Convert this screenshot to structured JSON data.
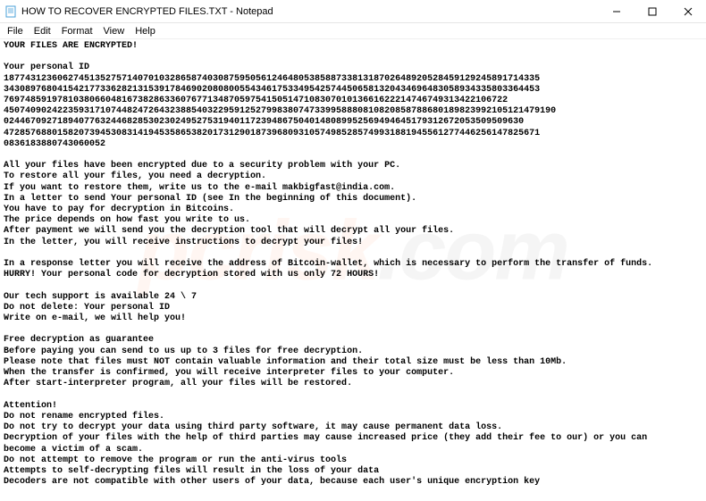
{
  "window": {
    "title": "HOW TO RECOVER ENCRYPTED FILES.TXT - Notepad",
    "app_icon": "notepad-icon"
  },
  "menu": {
    "items": [
      "File",
      "Edit",
      "Format",
      "View",
      "Help"
    ]
  },
  "watermark": {
    "a": "pcrisk",
    "b": ".com"
  },
  "body_text": "YOUR FILES ARE ENCRYPTED!\n\nYour personal ID\n1877431236062745135275714070103286587403087595056124648053858873381318702648920528459129245891714335\n3430897680415421773362821315391784690208080055434617533495425744506581320434696483058934335803364453\n7697485919781038066048167382863360767713487059754150514710830701013661622214746749313422106722\n4507409024223593171074482472643238854032295912527998380747339958880810820858788680189823992105121479190\n0244670927189407763244682853023024952753194011723948675040148089952569494645179312672053509509630\n4728576880158207394530831419453586538201731290187396809310574985285749931881945561277446256147825671\n0836183880743060052\n\nAll your files have been encrypted due to a security problem with your PC.\nTo restore all your files, you need a decryption.\nIf you want to restore them, write us to the e-mail makbigfast@india.com.\nIn a letter to send Your personal ID (see In the beginning of this document).\nYou have to pay for decryption in Bitcoins.\nThe price depends on how fast you write to us.\nAfter payment we will send you the decryption tool that will decrypt all your files.\nIn the letter, you will receive instructions to decrypt your files!\n\nIn a response letter you will receive the address of Bitcoin-wallet, which is necessary to perform the transfer of funds.\nHURRY! Your personal code for decryption stored with us only 72 HOURS!\n\nOur tech support is available 24 \\ 7\nDo not delete: Your personal ID\nWrite on e-mail, we will help you!\n\nFree decryption as guarantee\nBefore paying you can send to us up to 3 files for free decryption.\nPlease note that files must NOT contain valuable information and their total size must be less than 10Mb.\nWhen the transfer is confirmed, you will receive interpreter files to your computer.\nAfter start-interpreter program, all your files will be restored.\n\nAttention!\nDo not rename encrypted files.\nDo not try to decrypt your data using third party software, it may cause permanent data loss.\nDecryption of your files with the help of third parties may cause increased price (they add their fee to our) or you can\nbecome a victim of a scam.\nDo not attempt to remove the program or run the anti-virus tools\nAttempts to self-decrypting files will result in the loss of your data\nDecoders are not compatible with other users of your data, because each user's unique encryption key"
}
